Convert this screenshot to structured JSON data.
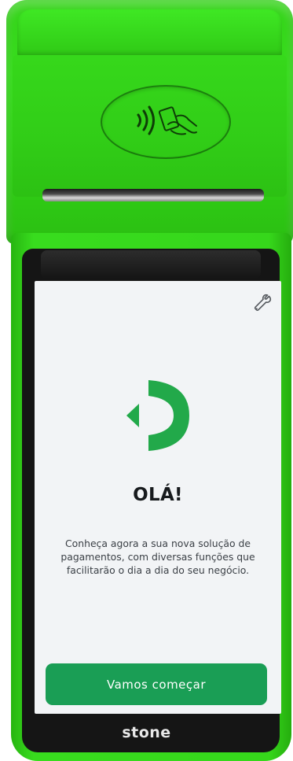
{
  "screen": {
    "greeting": "OLÁ!",
    "description": "Conheça agora a sua nova solução de pagamentos, com diversas funções que facilitarão o dia a dia do seu negócio.",
    "cta_label": "Vamos começar"
  },
  "device": {
    "brand": "stone"
  },
  "icons": {
    "settings": "wrench-icon",
    "logo": "stone-logo-icon",
    "nfc": "contactless-payment-icon"
  },
  "colors": {
    "device_body": "#36d71b",
    "accent": "#1a9e55",
    "screen_background": "#f2f4f6",
    "logo_green": "#22a94a"
  }
}
